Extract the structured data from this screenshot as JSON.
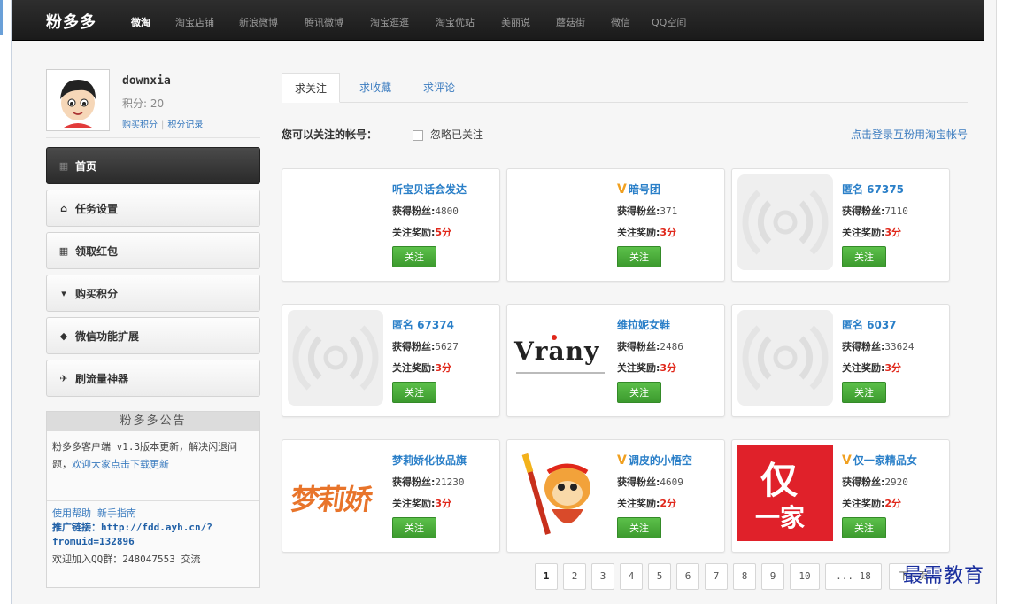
{
  "topnav": {
    "brand": "粉多多",
    "items": [
      "微淘",
      "淘宝店铺",
      "新浪微博",
      "腾讯微博",
      "淘宝逛逛",
      "淘宝优站",
      "美丽说",
      "蘑菇街",
      "微信",
      "QQ空间"
    ]
  },
  "profile": {
    "username": "downxia",
    "points": "积分: 20",
    "buy_points": "购买积分",
    "points_log": "积分记录"
  },
  "menu": [
    {
      "label": "首页",
      "icon": "grid-icon",
      "glyph": "▦"
    },
    {
      "label": "任务设置",
      "icon": "home-icon",
      "glyph": "⌂"
    },
    {
      "label": "领取红包",
      "icon": "gift-icon",
      "glyph": "▦"
    },
    {
      "label": "购买积分",
      "icon": "cart-icon",
      "glyph": "▾"
    },
    {
      "label": "微信功能扩展",
      "icon": "diamond-icon",
      "glyph": "◆"
    },
    {
      "label": "刷流量神器",
      "icon": "plane-icon",
      "glyph": "✈"
    }
  ],
  "notice": {
    "title": "粉多多公告",
    "text1": "粉多多客户端 v1.3版本更新，解决闪退问题，",
    "text2": "欢迎大家点击下载更新",
    "help": "使用帮助",
    "guide": "新手指南",
    "promo": "推广链接：http://fdd.ayh.cn/?fromuid=132896",
    "qq": "欢迎加入QQ群：248047553 交流"
  },
  "tabs": [
    "求关注",
    "求收藏",
    "求评论"
  ],
  "filter": {
    "label": "您可以关注的帐号：",
    "checkbox_label": "忽略已关注",
    "login_link": "点击登录互粉用淘宝帐号"
  },
  "labels": {
    "fans": "获得粉丝:",
    "reward": "关注奖励:",
    "follow": "关注"
  },
  "cards": [
    {
      "name": "听宝贝话会发达",
      "v": false,
      "fans": "4800",
      "reward": "5分",
      "thumb": "blank"
    },
    {
      "name": "暗号团",
      "v": true,
      "fans": "371",
      "reward": "3分",
      "thumb": "blank"
    },
    {
      "name": "匿名 67375",
      "v": false,
      "fans": "7110",
      "reward": "3分",
      "thumb": "placeholder"
    },
    {
      "name": "匿名 67374",
      "v": false,
      "fans": "5627",
      "reward": "3分",
      "thumb": "placeholder"
    },
    {
      "name": "维拉妮女鞋",
      "v": false,
      "fans": "2486",
      "reward": "3分",
      "thumb": "vrany"
    },
    {
      "name": "匿名 6037",
      "v": false,
      "fans": "33624",
      "reward": "3分",
      "thumb": "placeholder"
    },
    {
      "name": "梦莉娇化妆品旗",
      "v": false,
      "fans": "21230",
      "reward": "3分",
      "thumb": "mengli"
    },
    {
      "name": "调皮的小悟空",
      "v": true,
      "fans": "4609",
      "reward": "2分",
      "thumb": "monkey"
    },
    {
      "name": "仅一家精品女",
      "v": true,
      "fans": "2920",
      "reward": "2分",
      "thumb": "jin"
    }
  ],
  "thumb_text": {
    "vrany": "Vrany",
    "mengli": "梦莉娇",
    "jin_top": "仅",
    "jin_bottom": "一家"
  },
  "pager": [
    "1",
    "2",
    "3",
    "4",
    "5",
    "6",
    "7",
    "8",
    "9",
    "10",
    "... 18",
    "下一页"
  ],
  "watermark": "最需教育",
  "colors": {
    "accent": "#3a7bbf",
    "follow": "#4cae3c",
    "reward": "#e0271a"
  }
}
